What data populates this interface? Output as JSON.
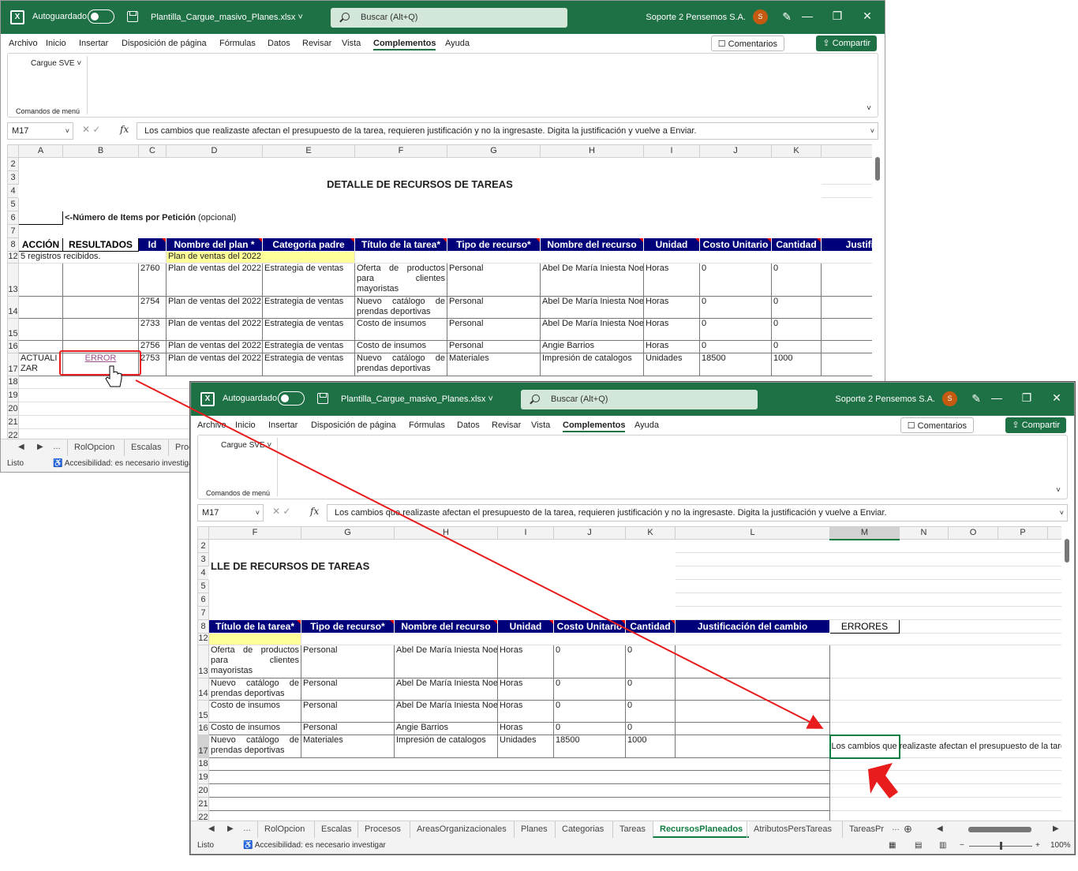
{
  "window": {
    "autosave_label": "Autoguardado",
    "filename": "Plantilla_Cargue_masivo_Planes.xlsx",
    "search_placeholder": "Buscar (Alt+Q)",
    "user_name": "Soporte 2 Pensemos S.A.",
    "avatar_initial": "S",
    "accent": "#1e7145"
  },
  "menu": {
    "items": [
      "Archivo",
      "Inicio",
      "Insertar",
      "Disposición de página",
      "Fórmulas",
      "Datos",
      "Revisar",
      "Vista",
      "Complementos",
      "Ayuda"
    ],
    "active": "Complementos",
    "comments_label": "Comentarios",
    "share_label": "Compartir"
  },
  "ribbon": {
    "cargue_label": "Cargue SVE",
    "group_label": "Comandos de menú"
  },
  "formula": {
    "cell_ref": "M17",
    "fx_symbol": "fx",
    "content": "Los cambios que realizaste afectan el presupuesto de la tarea, requieren justificación y no la ingresaste. Digita la justificación y vuelve a Enviar."
  },
  "sheet": {
    "title": "DETALLE DE RECURSOS  DE TAREAS",
    "title_cut": "LLE DE RECURSOS  DE TAREAS",
    "items_label_bold": "<-Número de Items por Petición",
    "items_label_normal": " (opcional)",
    "headers": {
      "accion": "ACCIÓN",
      "resultados": "RESULTADOS",
      "id": "Id",
      "plan": "Nombre del plan *",
      "categoria": "Categoria padre",
      "titulo": "Título de la tarea*",
      "tipo": "Tipo de recurso*",
      "recurso": "Nombre del recurso",
      "unidad": "Unidad",
      "costo": "Costo Unitario",
      "cantidad": "Cantidad",
      "justif_cut": "Justifi",
      "justif": "Justificación del cambio",
      "errores": "ERRORES"
    },
    "row12": {
      "accion": "5 registros recibidos.",
      "plan": "Plan de ventas del 2022"
    },
    "rows": [
      {
        "n": "13",
        "id": "2760",
        "plan": "Plan de ventas del 2022",
        "categoria": "Estrategia de ventas",
        "titulo": "Oferta de productos para clientes mayoristas",
        "tipo": "Personal",
        "recurso": "Abel De María Iniesta Noel",
        "unidad": "Horas",
        "costo": "0",
        "cantidad": "0"
      },
      {
        "n": "14",
        "id": "2754",
        "plan": "Plan de ventas del 2022",
        "categoria": "Estrategia de ventas",
        "titulo": "Nuevo catálogo de prendas deportivas",
        "tipo": "Personal",
        "recurso": "Abel De María Iniesta Noel",
        "unidad": "Horas",
        "costo": "0",
        "cantidad": "0"
      },
      {
        "n": "15",
        "id": "2733",
        "plan": "Plan de ventas del 2022",
        "categoria": "Estrategia de ventas",
        "titulo": "Costo de insumos",
        "tipo": "Personal",
        "recurso": "Abel De María Iniesta Noel",
        "unidad": "Horas",
        "costo": "0",
        "cantidad": "0"
      },
      {
        "n": "16",
        "id": "2756",
        "plan": "Plan de ventas del 2022",
        "categoria": "Estrategia de ventas",
        "titulo": "Costo de insumos",
        "tipo": "Personal",
        "recurso": "Angie Barrios",
        "unidad": "Horas",
        "costo": "0",
        "cantidad": "0"
      },
      {
        "n": "17",
        "accion": "ACTUALIZAR",
        "resultado": "ERROR",
        "id": "2753",
        "plan": "Plan de ventas del 2022",
        "categoria": "Estrategia de ventas",
        "titulo": "Nuevo catálogo de prendas deportivas",
        "tipo": "Materiales",
        "recurso": "Impresión de catalogos",
        "unidad": "Unidades",
        "costo": "18500",
        "cantidad": "1000",
        "error": "Los cambios que realizaste afectan el presupuesto de la tarea"
      }
    ]
  },
  "tabs1": [
    "RolOpcion",
    "Escalas",
    "Proc"
  ],
  "tabs2": [
    "RolOpcion",
    "Escalas",
    "Procesos",
    "AreasOrganizacionales",
    "Planes",
    "Categorias",
    "Tareas",
    "RecursosPlaneados",
    "AtributosPersTareas",
    "TareasPr"
  ],
  "active_tab": "RecursosPlaneados",
  "status": {
    "ready": "Listo",
    "accessibility": "Accesibilidad: es necesario investigar",
    "zoom": "100%"
  },
  "annotation_color": "#e81c1c"
}
